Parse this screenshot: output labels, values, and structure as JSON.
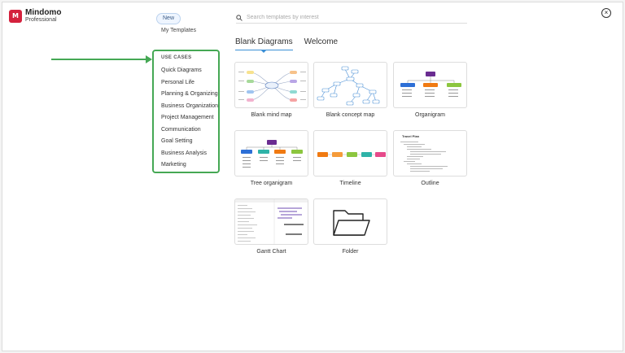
{
  "app": {
    "name": "Mindomo",
    "edition": "Professional",
    "logo_mark": "M"
  },
  "close_icon": "×",
  "sidebar": {
    "new_label": "New",
    "my_templates_label": "My Templates",
    "use_cases_title": "USE CASES",
    "items": [
      {
        "label": "Quick Diagrams"
      },
      {
        "label": "Personal Life"
      },
      {
        "label": "Planning & Organizing"
      },
      {
        "label": "Business Organization"
      },
      {
        "label": "Project Management"
      },
      {
        "label": "Communication"
      },
      {
        "label": "Goal Setting"
      },
      {
        "label": "Business Analysis"
      },
      {
        "label": "Marketing"
      }
    ]
  },
  "search": {
    "placeholder": "Search templates by interest"
  },
  "tabs": [
    {
      "label": "Blank Diagrams",
      "active": true
    },
    {
      "label": "Welcome",
      "active": false
    }
  ],
  "templates": [
    {
      "label": "Blank mind map",
      "icon": "mind-map-thumbnail"
    },
    {
      "label": "Blank concept map",
      "icon": "concept-map-thumbnail"
    },
    {
      "label": "Organigram",
      "icon": "organigram-thumbnail"
    },
    {
      "label": "Tree organigram",
      "icon": "tree-organigram-thumbnail"
    },
    {
      "label": "Timeline",
      "icon": "timeline-thumbnail"
    },
    {
      "label": "Outline",
      "icon": "outline-thumbnail"
    },
    {
      "label": "Gantt Chart",
      "icon": "gantt-chart-thumbnail"
    },
    {
      "label": "Folder",
      "icon": "folder-icon"
    }
  ],
  "outline_thumb_title": "Travel Plan",
  "colors": {
    "brand": "#d4213d",
    "highlight_box": "#45a854",
    "tab_accent": "#3b8fd6",
    "node_purple": "#6a2c91",
    "node_blue": "#2d6fd6",
    "node_teal": "#2fb3a8",
    "node_orange": "#f07a12",
    "node_lime": "#8cc63f",
    "node_pink": "#e64a8a"
  }
}
